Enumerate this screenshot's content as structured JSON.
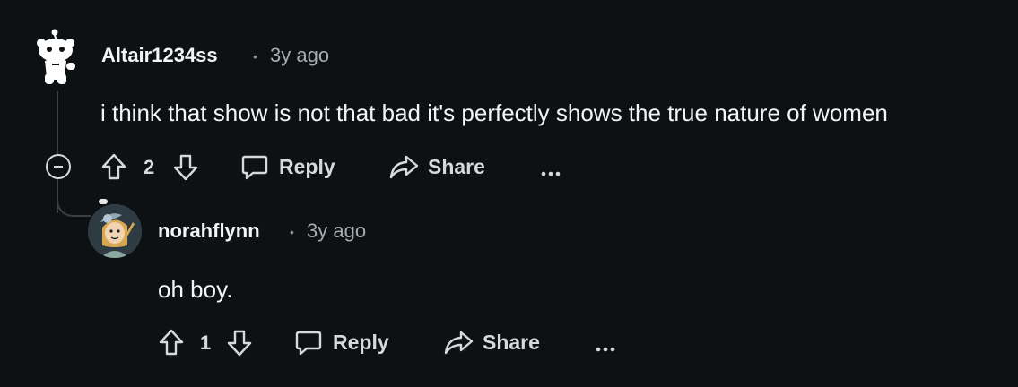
{
  "comments": [
    {
      "username": "Altair1234ss",
      "separator": "•",
      "time": "3y ago",
      "body": "i think that show is not that bad it's perfectly shows the true nature of women",
      "votes": "2",
      "reply_label": "Reply",
      "share_label": "Share",
      "more_label": "•••"
    },
    {
      "username": "norahflynn",
      "separator": "•",
      "time": "3y ago",
      "body": "oh boy.",
      "votes": "1",
      "reply_label": "Reply",
      "share_label": "Share",
      "more_label": "•••"
    }
  ],
  "colors": {
    "background": "#0e1113",
    "text": "#f2f4f5",
    "muted": "#a6adb2",
    "thread_line": "#3a3f44"
  }
}
